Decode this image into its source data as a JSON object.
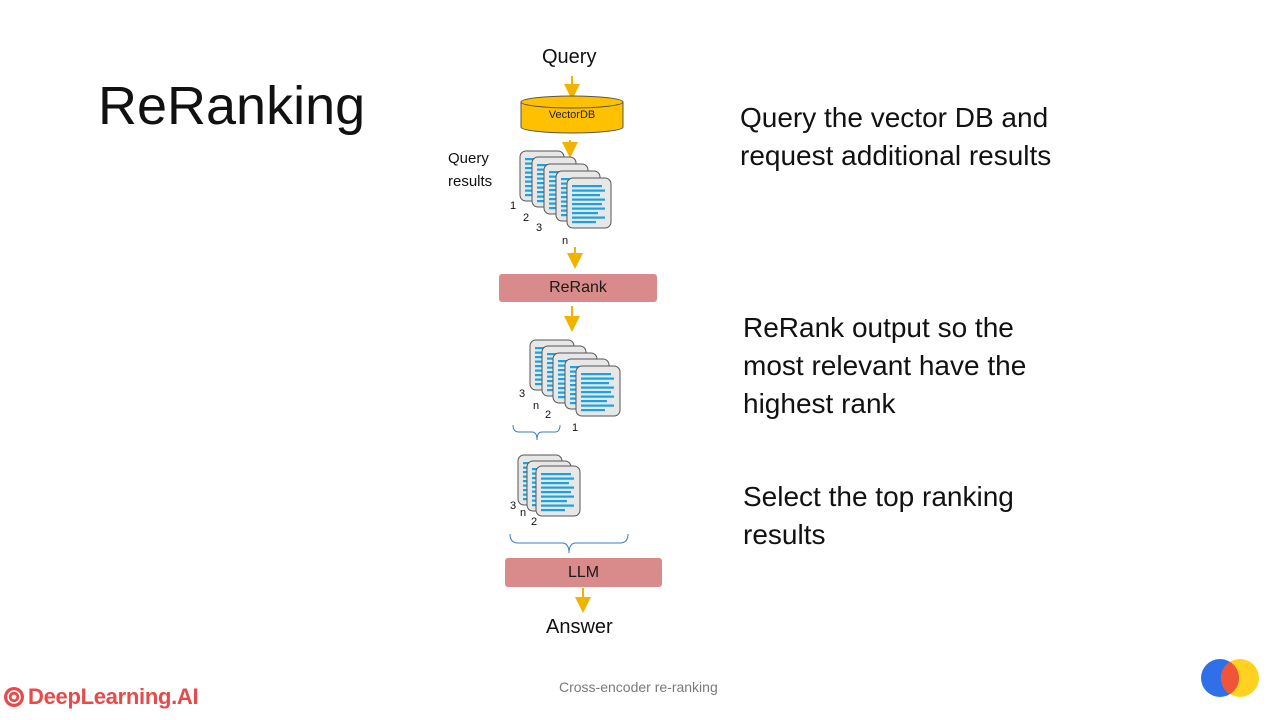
{
  "slide": {
    "title": "ReRanking",
    "footer": "Cross-encoder re-ranking"
  },
  "diagram": {
    "query_label": "Query",
    "vectordb_label": "VectorDB",
    "query_results_label_line1": "Query",
    "query_results_label_line2": "results",
    "stack1_ranks": [
      "1",
      "2",
      "3",
      "n"
    ],
    "rerank_label": "ReRank",
    "stack2_ranks": [
      "3",
      "n",
      "2",
      "1"
    ],
    "stack3_ranks": [
      "3",
      "n",
      "2"
    ],
    "llm_label": "LLM",
    "answer_label": "Answer"
  },
  "descriptions": {
    "step1_line1": "Query the vector DB and",
    "step1_line2": "request additional results",
    "step2_line1": "ReRank output so the",
    "step2_line2": "most relevant have the",
    "step2_line3": "highest rank",
    "step3_line1": "Select the top ranking",
    "step3_line2": "results"
  },
  "branding": {
    "logo_text": "DeepLearning.AI"
  },
  "colors": {
    "arrow": "#f0b400",
    "vectordb_fill": "#ffc000",
    "box_fill": "#d98a8a",
    "doc_line": "#1aa3e0",
    "brand_red": "#e84a4a"
  }
}
